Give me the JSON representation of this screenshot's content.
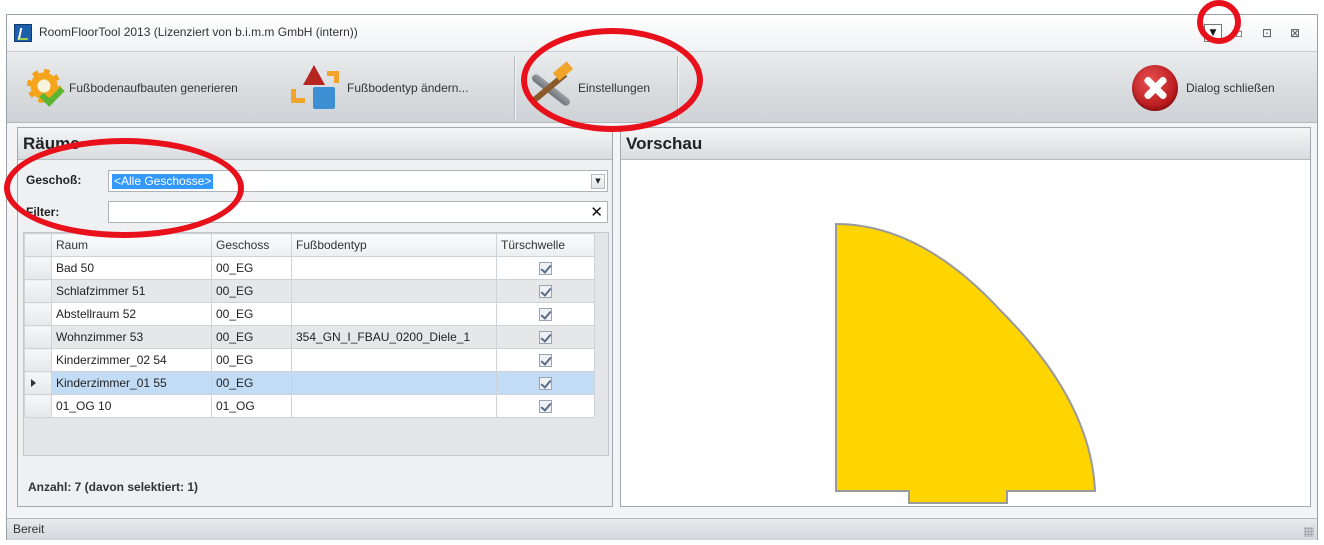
{
  "window": {
    "title": "RoomFloorTool 2013 (Lizenziert von b.i.m.m GmbH (intern))"
  },
  "window_controls": {
    "dropdown": "▼",
    "minimize": "▫",
    "maximize": "⊡",
    "close": "⊠"
  },
  "toolbar": {
    "generate_label": "Fußbodenaufbauten generieren",
    "change_type_label": "Fußbodentyp ändern...",
    "settings_label": "Einstellungen",
    "close_dialog_label": "Dialog schließen"
  },
  "rooms_panel": {
    "title": "Räume",
    "floor_label": "Geschoß:",
    "floor_value": "<Alle Geschosse>",
    "filter_label": "Filter:",
    "filter_value": "",
    "filter_clear": "✕",
    "columns": [
      "Raum",
      "Geschoss",
      "Fußbodentyp",
      "Türschwelle"
    ],
    "rows": [
      {
        "raum": "Bad 50",
        "geschoss": "00_EG",
        "typ": "",
        "schwelle": true
      },
      {
        "raum": "Schlafzimmer 51",
        "geschoss": "00_EG",
        "typ": "",
        "schwelle": true
      },
      {
        "raum": "Abstellraum 52",
        "geschoss": "00_EG",
        "typ": "",
        "schwelle": true
      },
      {
        "raum": "Wohnzimmer 53",
        "geschoss": "00_EG",
        "typ": "354_GN_I_FBAU_0200_Diele_1",
        "schwelle": true
      },
      {
        "raum": "Kinderzimmer_02 54",
        "geschoss": "00_EG",
        "typ": "",
        "schwelle": true
      },
      {
        "raum": "Kinderzimmer_01 55",
        "geschoss": "00_EG",
        "typ": "",
        "schwelle": true
      },
      {
        "raum": "01_OG 10",
        "geschoss": "01_OG",
        "typ": "",
        "schwelle": true
      }
    ],
    "selected_row": 5,
    "count_text": "Anzahl: 7 (davon selektiert: 1)"
  },
  "preview_panel": {
    "title": "Vorschau",
    "shape_fill": "#ffd500",
    "shape_stroke": "#9a9a9a"
  },
  "status": {
    "text": "Bereit"
  },
  "colors": {
    "annotation": "#e8101b",
    "selection": "#c3dcf5",
    "highlight": "#3399ff"
  }
}
